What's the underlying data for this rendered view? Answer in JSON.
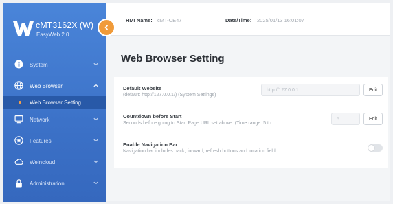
{
  "brand": {
    "model": "cMT3162X (W)",
    "subtitle": "EasyWeb 2.0"
  },
  "nav": {
    "items": [
      {
        "label": "System",
        "icon": "info-icon"
      },
      {
        "label": "Web Browser",
        "icon": "globe-icon",
        "expanded": true,
        "subitems": [
          {
            "label": "Web Browser Setting",
            "selected": true
          }
        ]
      },
      {
        "label": "Network",
        "icon": "monitor-icon"
      },
      {
        "label": "Features",
        "icon": "star-icon"
      },
      {
        "label": "Weincloud",
        "icon": "cloud-icon"
      },
      {
        "label": "Administration",
        "icon": "lock-icon"
      }
    ]
  },
  "header": {
    "hmi_name_label": "HMI Name:",
    "hmi_name_value": "cMT-CE47",
    "datetime_label": "Date/Time:",
    "datetime_value": "2025/01/13 16:01:07"
  },
  "page": {
    "title": "Web Browser Setting",
    "rows": [
      {
        "title": "Default Website",
        "desc": "(default: http://127.0.0.1/) (System Settings)",
        "value": "http://127.0.0.1",
        "button": "Edit"
      },
      {
        "title": "Countdown before Start",
        "desc": "Seconds before going to Start Page URL set above. (Time range: 5 to ...",
        "value": "5",
        "button": "Edit"
      },
      {
        "title": "Enable Navigation Bar",
        "desc": "Navigation bar includes back, forward, refresh buttons and location field.",
        "enabled": false
      }
    ]
  },
  "colors": {
    "sidebar": "#3c72c8",
    "accent": "#f09b3a",
    "selected_sub": "#2859a8"
  }
}
